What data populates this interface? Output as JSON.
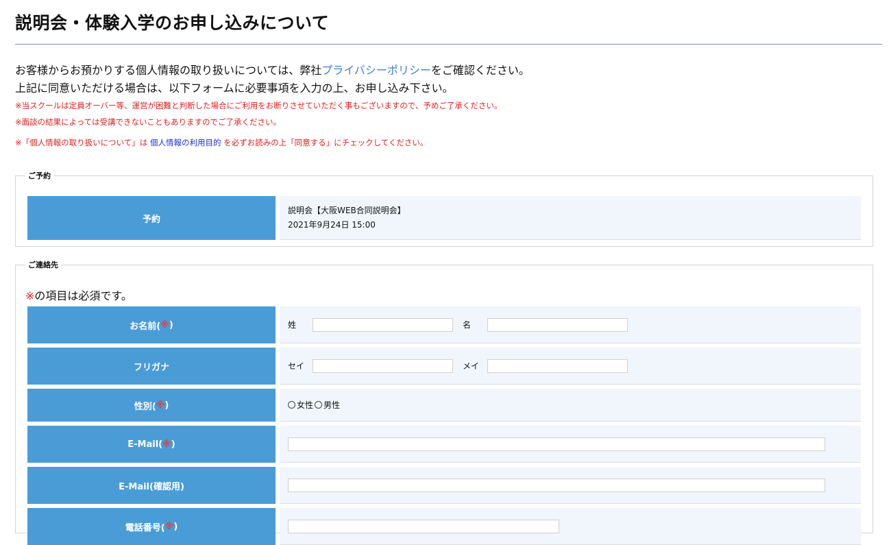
{
  "page": {
    "title": "説明会・体験入学のお申し込みについて"
  },
  "intro": {
    "line1_before": "お客様からお預かりする個人情報の取り扱いについては、弊社",
    "line1_link": "プライバシーポリシー",
    "line1_after": "をご確認ください。",
    "line2": "上記に同意いただける場合は、以下フォームに必要事項を入力の上、お申し込み下さい。",
    "note1": "※当スクールは定員オーバー等、運営が困難と判断した場合にご利用をお断りさせていただく事もございますので、予めご了承ください。",
    "note2": "※面談の結果によっては受講できないこともありますのでご了承ください。",
    "note3_before": "※「個人情報の取り扱いについて」は",
    "note3_link": "個人情報の利用目的",
    "note3_after": "を必ずお読みの上「同意する」にチェックしてください。"
  },
  "reservation": {
    "legend": "ご予約",
    "label": "予約",
    "value_line1": "説明会【大阪WEB合同説明会】",
    "value_line2": "2021年9月24日 15:00"
  },
  "contact": {
    "legend": "ご連絡先",
    "required_mark": "※",
    "required_text": "の項目は必須です。",
    "name": {
      "label": "お名前(",
      "req": "※",
      "label_end": ")",
      "last_label": "姓",
      "first_label": "名",
      "last_value": "",
      "first_value": ""
    },
    "furigana": {
      "label": "フリガナ",
      "last_label": "セイ",
      "first_label": "メイ",
      "last_value": "",
      "first_value": ""
    },
    "gender": {
      "label": "性別(",
      "req": "※",
      "label_end": ")",
      "options": [
        "女性",
        "男性"
      ]
    },
    "email": {
      "label": "E-Mail(",
      "req": "※",
      "label_end": ")",
      "value": ""
    },
    "email_confirm": {
      "label": "E-Mail(確認用)",
      "value": ""
    },
    "phone": {
      "label": "電話番号(",
      "req": "※",
      "label_end": ")",
      "value": ""
    }
  },
  "colors": {
    "label_bg": "#4a9cd6",
    "field_bg": "#f0f6fb",
    "required": "#e04040",
    "link": "#3f7fd1",
    "note_red": "#e02020"
  }
}
